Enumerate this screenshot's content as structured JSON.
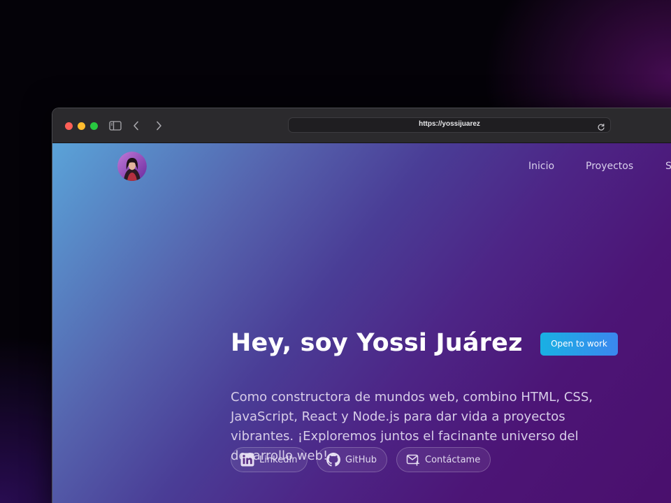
{
  "browser": {
    "url": "https://yossijuarez",
    "icons": [
      "sidebar-icon",
      "chevron-left-icon",
      "chevron-right-icon",
      "reload-icon"
    ]
  },
  "nav": {
    "links": [
      "Inicio",
      "Proyectos",
      "S"
    ]
  },
  "hero": {
    "title": "Hey, soy Yossi Juárez",
    "badge": "Open to work",
    "description": "Como constructora de mundos web, combino HTML, CSS, JavaScript, React y Node.js para dar vida a proyectos vibrantes. ¡Exploremos juntos el facinante universo del desarrollo web!",
    "buttons": [
      {
        "label": "LinkedIn",
        "icon": "linkedin-icon"
      },
      {
        "label": "GitHub",
        "icon": "github-icon"
      },
      {
        "label": "Contáctame",
        "icon": "mail-icon"
      }
    ]
  },
  "colors": {
    "badge_start": "#19b0e3",
    "badge_end": "#3b87ef",
    "page_gradient_start": "#5aa3d8",
    "page_gradient_end": "#4a0f6c"
  }
}
